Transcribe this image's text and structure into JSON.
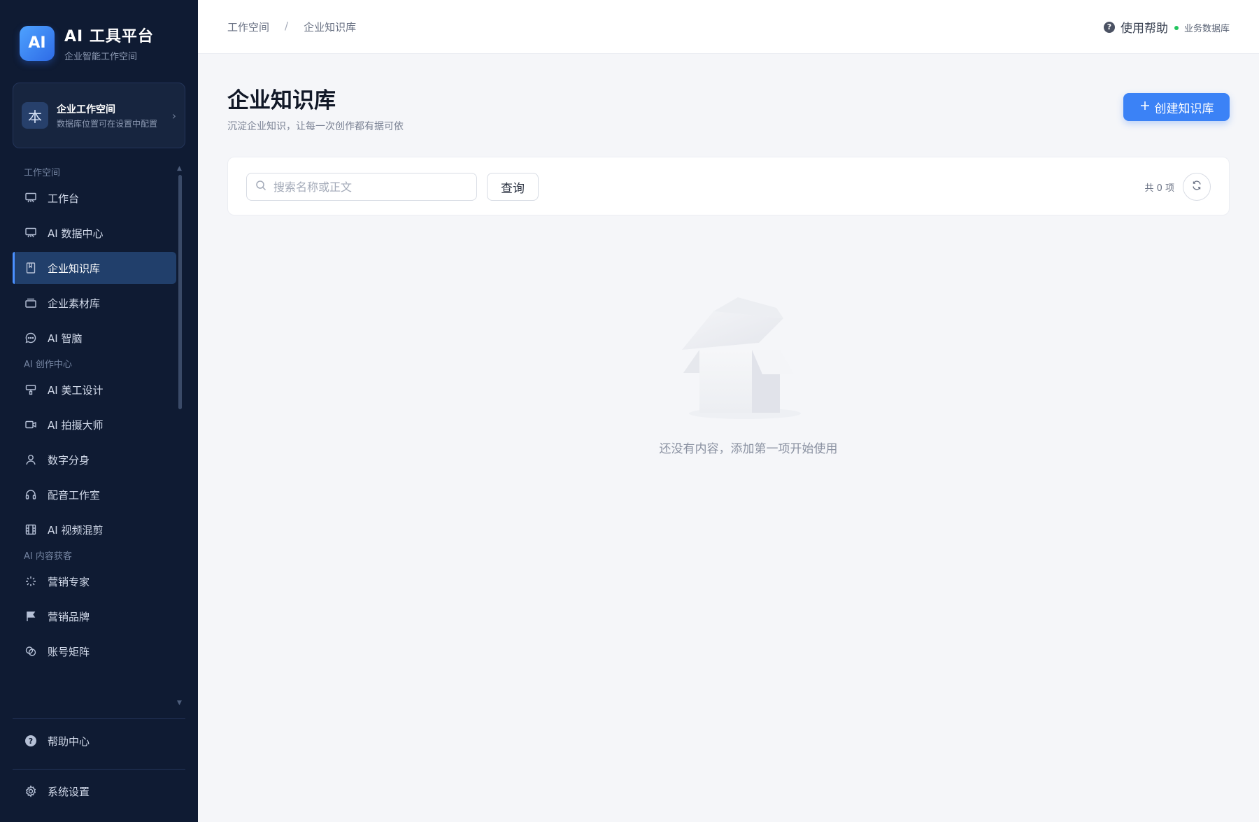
{
  "brand": {
    "logo": "AI",
    "title": "AI 工具平台",
    "subtitle": "企业智能工作空间"
  },
  "workspace": {
    "avatar": "本",
    "name": "企业工作空间",
    "desc": "数据库位置可在设置中配置"
  },
  "nav": {
    "sections": [
      {
        "title": "工作空间",
        "items": [
          {
            "label": "工作台",
            "icon": "presentation-icon"
          },
          {
            "label": "AI 数据中心",
            "icon": "presentation-icon"
          },
          {
            "label": "企业知识库",
            "icon": "book-icon",
            "active": true
          },
          {
            "label": "企业素材库",
            "icon": "layers-icon"
          },
          {
            "label": "AI 智脑",
            "icon": "chat-icon"
          }
        ]
      },
      {
        "title": "AI 创作中心",
        "items": [
          {
            "label": "AI 美工设计",
            "icon": "paint-icon"
          },
          {
            "label": "AI 拍摄大师",
            "icon": "video-icon"
          },
          {
            "label": "数字分身",
            "icon": "user-icon"
          },
          {
            "label": "配音工作室",
            "icon": "headphones-icon"
          },
          {
            "label": "AI 视频混剪",
            "icon": "film-icon"
          }
        ]
      },
      {
        "title": "AI 内容获客",
        "items": [
          {
            "label": "营销专家",
            "icon": "sparkle-icon"
          },
          {
            "label": "营销品牌",
            "icon": "flag-icon"
          },
          {
            "label": "账号矩阵",
            "icon": "links-icon"
          }
        ]
      }
    ]
  },
  "bottom": {
    "help": "帮助中心",
    "settings": "系统设置"
  },
  "topbar": {
    "breadcrumb": [
      "工作空间",
      "企业知识库"
    ],
    "separator": "/",
    "help": "使用帮助",
    "db_status": "业务数据库"
  },
  "page": {
    "title": "企业知识库",
    "subtitle": "沉淀企业知识，让每一次创作都有据可依",
    "create_button": "创建知识库"
  },
  "filter": {
    "search_placeholder": "搜索名称或正文",
    "search_value": "",
    "query_button": "查询",
    "count": "共 0 项"
  },
  "empty": {
    "text": "还没有内容，添加第一项开始使用"
  },
  "colors": {
    "sidebar_bg": "#0f1b33",
    "accent": "#3b82f6",
    "active_item": "#213f6b",
    "status_ok": "#22c55e"
  }
}
